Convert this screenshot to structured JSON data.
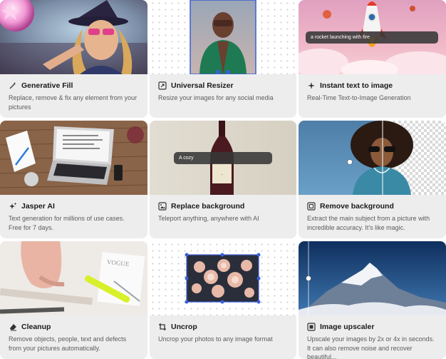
{
  "cards": [
    {
      "title": "Generative Fill",
      "desc": "Replace, remove & fix any element from your pictures",
      "icon": "magic-wand-icon"
    },
    {
      "title": "Universal Resizer",
      "desc": "Resize your images for any social media",
      "icon": "resize-icon"
    },
    {
      "title": "Instant text to image",
      "desc": "Real-Time Text-to-Image Generation",
      "icon": "spark-icon",
      "prompt": "a rocket launching with fire"
    },
    {
      "title": "Jasper AI",
      "desc": "Text generation for millions of use cases. Free for 7 days.",
      "icon": "sparkles-icon"
    },
    {
      "title": "Replace background",
      "desc": "Teleport anything, anywhere with AI",
      "icon": "image-replace-icon",
      "prompt": "A cozy"
    },
    {
      "title": "Remove background",
      "desc": "Extract the main subject from a picture with incredible accuracy. It's like magic.",
      "icon": "remove-bg-icon"
    },
    {
      "title": "Cleanup",
      "desc": "Remove objects, people, text and defects from your pictures automatically.",
      "icon": "eraser-icon"
    },
    {
      "title": "Uncrop",
      "desc": "Uncrop your photos to any image format",
      "icon": "uncrop-icon"
    },
    {
      "title": "Image upscaler",
      "desc": "Upscale your images by 2x or 4x in seconds. It can also remove noise and recover beautiful...",
      "icon": "upscale-icon"
    }
  ]
}
